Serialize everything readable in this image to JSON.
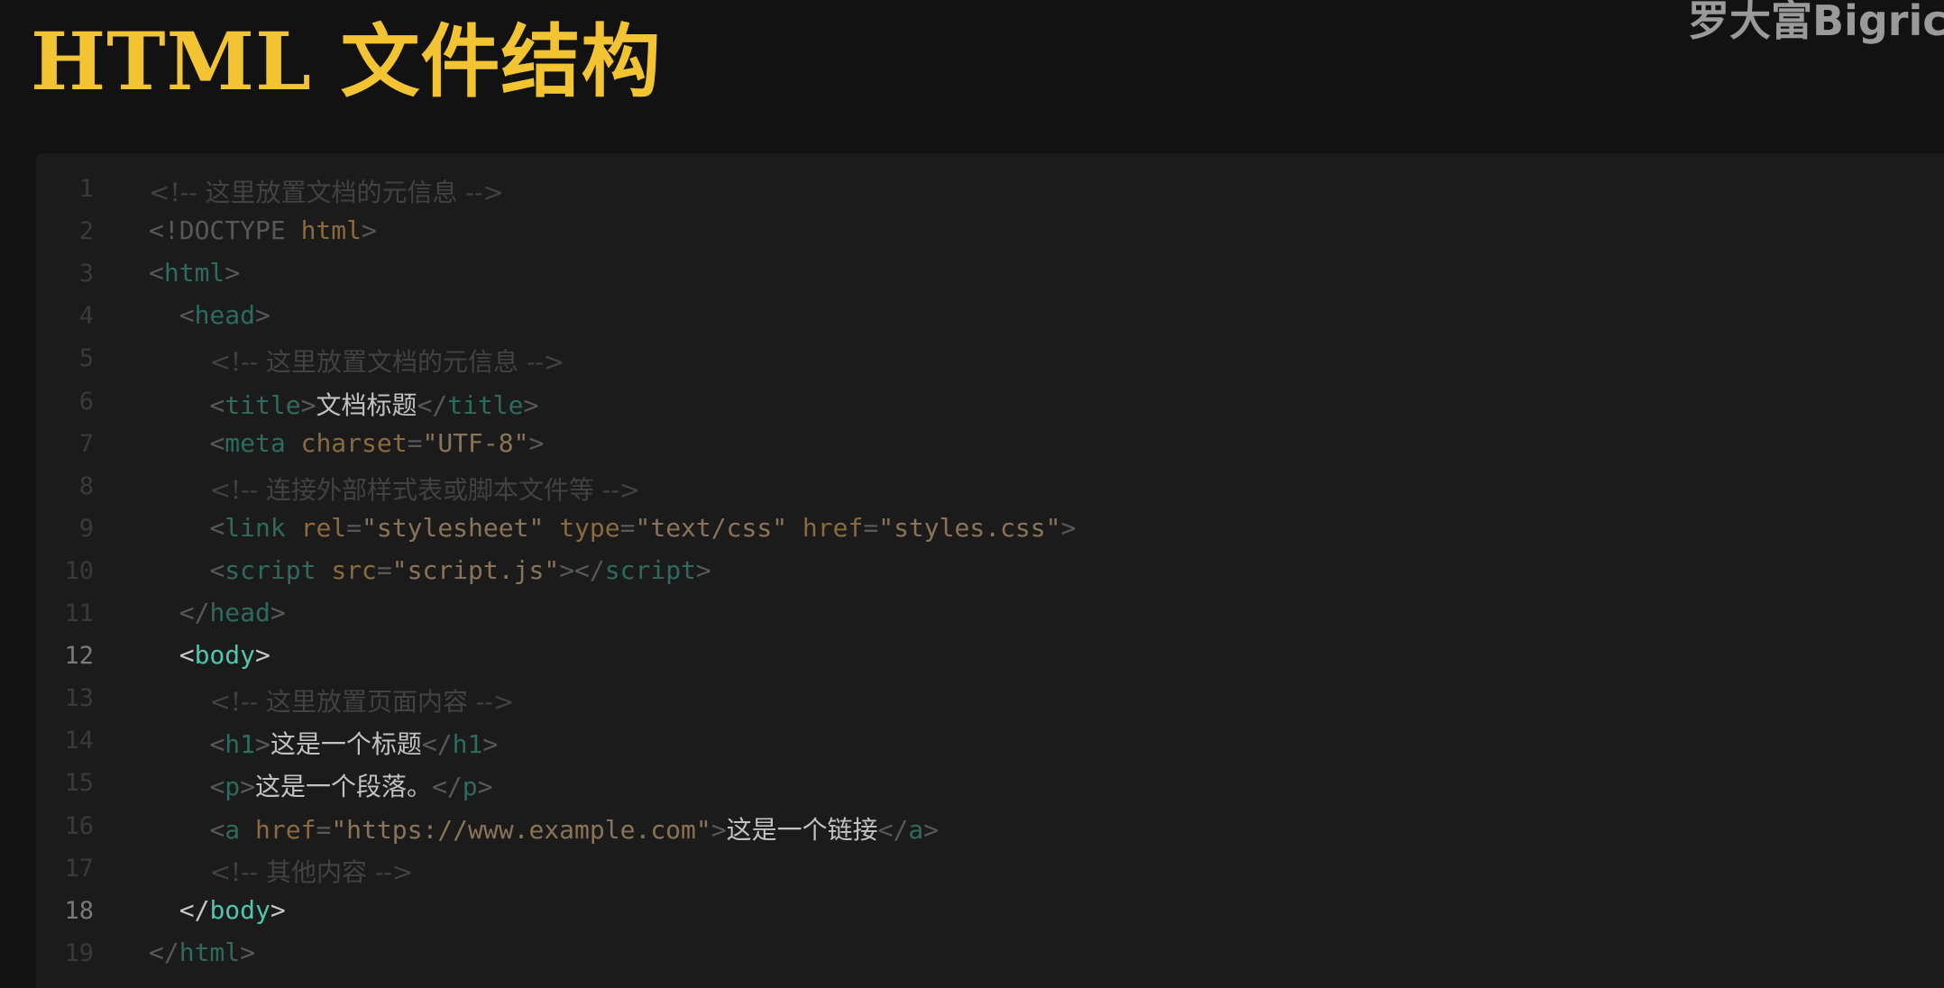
{
  "title": "HTML 文件结构",
  "watermark": "罗大富Bigrich",
  "colors": {
    "title": "#f3c431",
    "background": "#121212",
    "panel": "#1b1b1b",
    "tag_active": "#4fc6ad",
    "tag_dim": "#2c6b5e"
  },
  "code": [
    {
      "n": "1",
      "indent": "",
      "active": false,
      "tokens": [
        {
          "t": "<!-- 这里放置文档的元信息 -->",
          "k": "comment"
        }
      ]
    },
    {
      "n": "2",
      "indent": "",
      "active": false,
      "tokens": [
        {
          "t": "<!DOCTYPE ",
          "k": "ptag"
        },
        {
          "t": "html",
          "k": "attr"
        },
        {
          "t": ">",
          "k": "ptag"
        }
      ]
    },
    {
      "n": "3",
      "indent": "",
      "active": false,
      "tokens": [
        {
          "t": "<",
          "k": "ptag"
        },
        {
          "t": "html",
          "k": "tag"
        },
        {
          "t": ">",
          "k": "ptag"
        }
      ]
    },
    {
      "n": "4",
      "indent": "  ",
      "active": false,
      "tokens": [
        {
          "t": "<",
          "k": "ptag"
        },
        {
          "t": "head",
          "k": "tag"
        },
        {
          "t": ">",
          "k": "ptag"
        }
      ]
    },
    {
      "n": "5",
      "indent": "    ",
      "active": false,
      "tokens": [
        {
          "t": "<!-- 这里放置文档的元信息 -->",
          "k": "comment"
        }
      ]
    },
    {
      "n": "6",
      "indent": "    ",
      "active": false,
      "tokens": [
        {
          "t": "<",
          "k": "ptag"
        },
        {
          "t": "title",
          "k": "tag"
        },
        {
          "t": ">",
          "k": "ptag"
        },
        {
          "t": "文档标题",
          "k": "text"
        },
        {
          "t": "</",
          "k": "ptag"
        },
        {
          "t": "title",
          "k": "tag"
        },
        {
          "t": ">",
          "k": "ptag"
        }
      ]
    },
    {
      "n": "7",
      "indent": "    ",
      "active": false,
      "tokens": [
        {
          "t": "<",
          "k": "ptag"
        },
        {
          "t": "meta",
          "k": "tag"
        },
        {
          "t": " ",
          "k": "plain"
        },
        {
          "t": "charset",
          "k": "attr"
        },
        {
          "t": "=",
          "k": "plain"
        },
        {
          "t": "\"UTF-8\"",
          "k": "str"
        },
        {
          "t": ">",
          "k": "ptag"
        }
      ]
    },
    {
      "n": "8",
      "indent": "    ",
      "active": false,
      "tokens": [
        {
          "t": "<!-- 连接外部样式表或脚本文件等 -->",
          "k": "comment"
        }
      ]
    },
    {
      "n": "9",
      "indent": "    ",
      "active": false,
      "tokens": [
        {
          "t": "<",
          "k": "ptag"
        },
        {
          "t": "link",
          "k": "tag"
        },
        {
          "t": " ",
          "k": "plain"
        },
        {
          "t": "rel",
          "k": "attr"
        },
        {
          "t": "=",
          "k": "plain"
        },
        {
          "t": "\"stylesheet\"",
          "k": "str"
        },
        {
          "t": " ",
          "k": "plain"
        },
        {
          "t": "type",
          "k": "attr"
        },
        {
          "t": "=",
          "k": "plain"
        },
        {
          "t": "\"text/css\"",
          "k": "str"
        },
        {
          "t": " ",
          "k": "plain"
        },
        {
          "t": "href",
          "k": "attr"
        },
        {
          "t": "=",
          "k": "plain"
        },
        {
          "t": "\"styles.css\"",
          "k": "str"
        },
        {
          "t": ">",
          "k": "ptag"
        }
      ]
    },
    {
      "n": "10",
      "indent": "    ",
      "active": false,
      "tokens": [
        {
          "t": "<",
          "k": "ptag"
        },
        {
          "t": "script",
          "k": "tag"
        },
        {
          "t": " ",
          "k": "plain"
        },
        {
          "t": "src",
          "k": "attr"
        },
        {
          "t": "=",
          "k": "plain"
        },
        {
          "t": "\"script.js\"",
          "k": "str"
        },
        {
          "t": "></",
          "k": "ptag"
        },
        {
          "t": "script",
          "k": "tag"
        },
        {
          "t": ">",
          "k": "ptag"
        }
      ]
    },
    {
      "n": "11",
      "indent": "  ",
      "active": false,
      "tokens": [
        {
          "t": "</",
          "k": "ptag"
        },
        {
          "t": "head",
          "k": "tag"
        },
        {
          "t": ">",
          "k": "ptag"
        }
      ]
    },
    {
      "n": "12",
      "indent": "  ",
      "active": true,
      "tokens": [
        {
          "t": "<",
          "k": "ptag"
        },
        {
          "t": "body",
          "k": "tag"
        },
        {
          "t": ">",
          "k": "ptag"
        }
      ]
    },
    {
      "n": "13",
      "indent": "    ",
      "active": false,
      "tokens": [
        {
          "t": "<!-- 这里放置页面内容 -->",
          "k": "comment"
        }
      ]
    },
    {
      "n": "14",
      "indent": "    ",
      "active": false,
      "tokens": [
        {
          "t": "<",
          "k": "ptag"
        },
        {
          "t": "h1",
          "k": "tag"
        },
        {
          "t": ">",
          "k": "ptag"
        },
        {
          "t": "这是一个标题",
          "k": "text"
        },
        {
          "t": "</",
          "k": "ptag"
        },
        {
          "t": "h1",
          "k": "tag"
        },
        {
          "t": ">",
          "k": "ptag"
        }
      ]
    },
    {
      "n": "15",
      "indent": "    ",
      "active": false,
      "tokens": [
        {
          "t": "<",
          "k": "ptag"
        },
        {
          "t": "p",
          "k": "tag"
        },
        {
          "t": ">",
          "k": "ptag"
        },
        {
          "t": "这是一个段落。",
          "k": "text"
        },
        {
          "t": "</",
          "k": "ptag"
        },
        {
          "t": "p",
          "k": "tag"
        },
        {
          "t": ">",
          "k": "ptag"
        }
      ]
    },
    {
      "n": "16",
      "indent": "    ",
      "active": false,
      "tokens": [
        {
          "t": "<",
          "k": "ptag"
        },
        {
          "t": "a",
          "k": "tag"
        },
        {
          "t": " ",
          "k": "plain"
        },
        {
          "t": "href",
          "k": "attr"
        },
        {
          "t": "=",
          "k": "plain"
        },
        {
          "t": "\"https://www.example.com\"",
          "k": "str"
        },
        {
          "t": ">",
          "k": "ptag"
        },
        {
          "t": "这是一个链接",
          "k": "text"
        },
        {
          "t": "</",
          "k": "ptag"
        },
        {
          "t": "a",
          "k": "tag"
        },
        {
          "t": ">",
          "k": "ptag"
        }
      ]
    },
    {
      "n": "17",
      "indent": "    ",
      "active": false,
      "tokens": [
        {
          "t": "<!-- 其他内容 -->",
          "k": "comment"
        }
      ]
    },
    {
      "n": "18",
      "indent": "  ",
      "active": true,
      "tokens": [
        {
          "t": "</",
          "k": "ptag"
        },
        {
          "t": "body",
          "k": "tag"
        },
        {
          "t": ">",
          "k": "ptag"
        }
      ]
    },
    {
      "n": "19",
      "indent": "",
      "active": false,
      "tokens": [
        {
          "t": "</",
          "k": "ptag"
        },
        {
          "t": "html",
          "k": "tag"
        },
        {
          "t": ">",
          "k": "ptag"
        }
      ]
    }
  ]
}
